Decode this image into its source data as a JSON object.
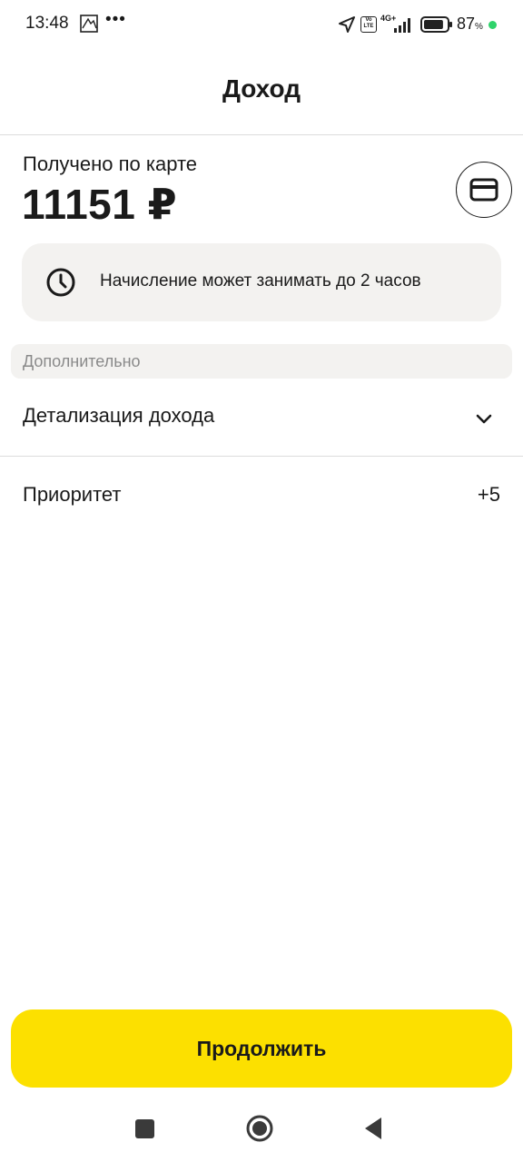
{
  "status_bar": {
    "time": "13:48",
    "dots": "•••",
    "volte": "Vo LTE",
    "network": "4G+",
    "battery_percent": "87",
    "battery_unit": "%",
    "battery_level": 0.87,
    "dot_color": "#2fd36b"
  },
  "header": {
    "title": "Доход"
  },
  "balance": {
    "label": "Получено по карте",
    "amount": "11151 ₽"
  },
  "info": {
    "text": "Начисление может занимать до 2 часов"
  },
  "section": {
    "title": "Дополнительно",
    "rows": [
      {
        "label": "Детализация дохода"
      },
      {
        "label": "Приоритет",
        "value": "+5"
      }
    ]
  },
  "actions": {
    "continue_label": "Продолжить",
    "accent_color": "#fce000"
  },
  "icons": {
    "card": "credit-card-icon",
    "clock": "clock-icon",
    "chevron": "chevron-down-icon"
  }
}
